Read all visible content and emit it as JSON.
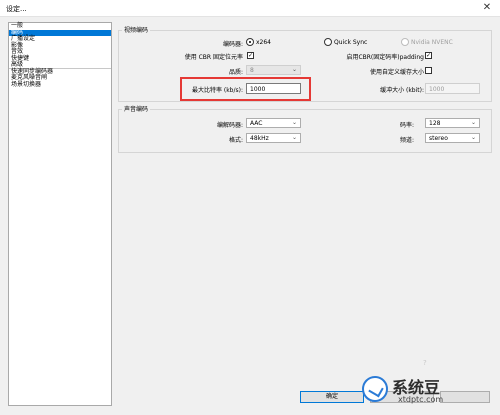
{
  "window": {
    "title": "设定..."
  },
  "nav": {
    "items": [
      {
        "label": "一般",
        "selected": false
      },
      {
        "label": "编码",
        "selected": true
      },
      {
        "label": "广播设定",
        "selected": false
      },
      {
        "label": "影像",
        "selected": false
      },
      {
        "label": "音效",
        "selected": false
      },
      {
        "label": "快捷键",
        "selected": false
      },
      {
        "label": "高级",
        "selected": false
      },
      {
        "label": "快速同步编码器",
        "selected": false
      },
      {
        "label": "麦克风噪音闸",
        "selected": false
      },
      {
        "label": "场景切换器",
        "selected": false
      }
    ]
  },
  "video": {
    "title": "视频编码",
    "encoder_label": "编码器:",
    "encoder_options": [
      "x264",
      "Quick Sync",
      "Nvidia NVENC"
    ],
    "cbr_label": "使用 CBR 固定位元率",
    "cbr_padding_label": "启用CBR(固定码率)padding",
    "quality_label": "品质:",
    "quality_value": "8",
    "custom_buffer_label": "使用自定义缓存大小",
    "max_bitrate_label": "最大比特率 (kb/s):",
    "max_bitrate_value": "1000",
    "buffer_size_label": "缓冲大小 (kbit):",
    "buffer_size_value": "1000"
  },
  "audio": {
    "title": "声音编码",
    "codec_label": "编解码器:",
    "codec_value": "AAC",
    "bitrate_label": "码率:",
    "bitrate_value": "128",
    "format_label": "格式:",
    "format_value": "48kHz",
    "channel_label": "频道:",
    "channel_value": "stereo"
  },
  "buttons": {
    "ok": "确定"
  },
  "watermark": {
    "title": "系统豆",
    "url": "xtdptc.com"
  },
  "hint_char": "?"
}
